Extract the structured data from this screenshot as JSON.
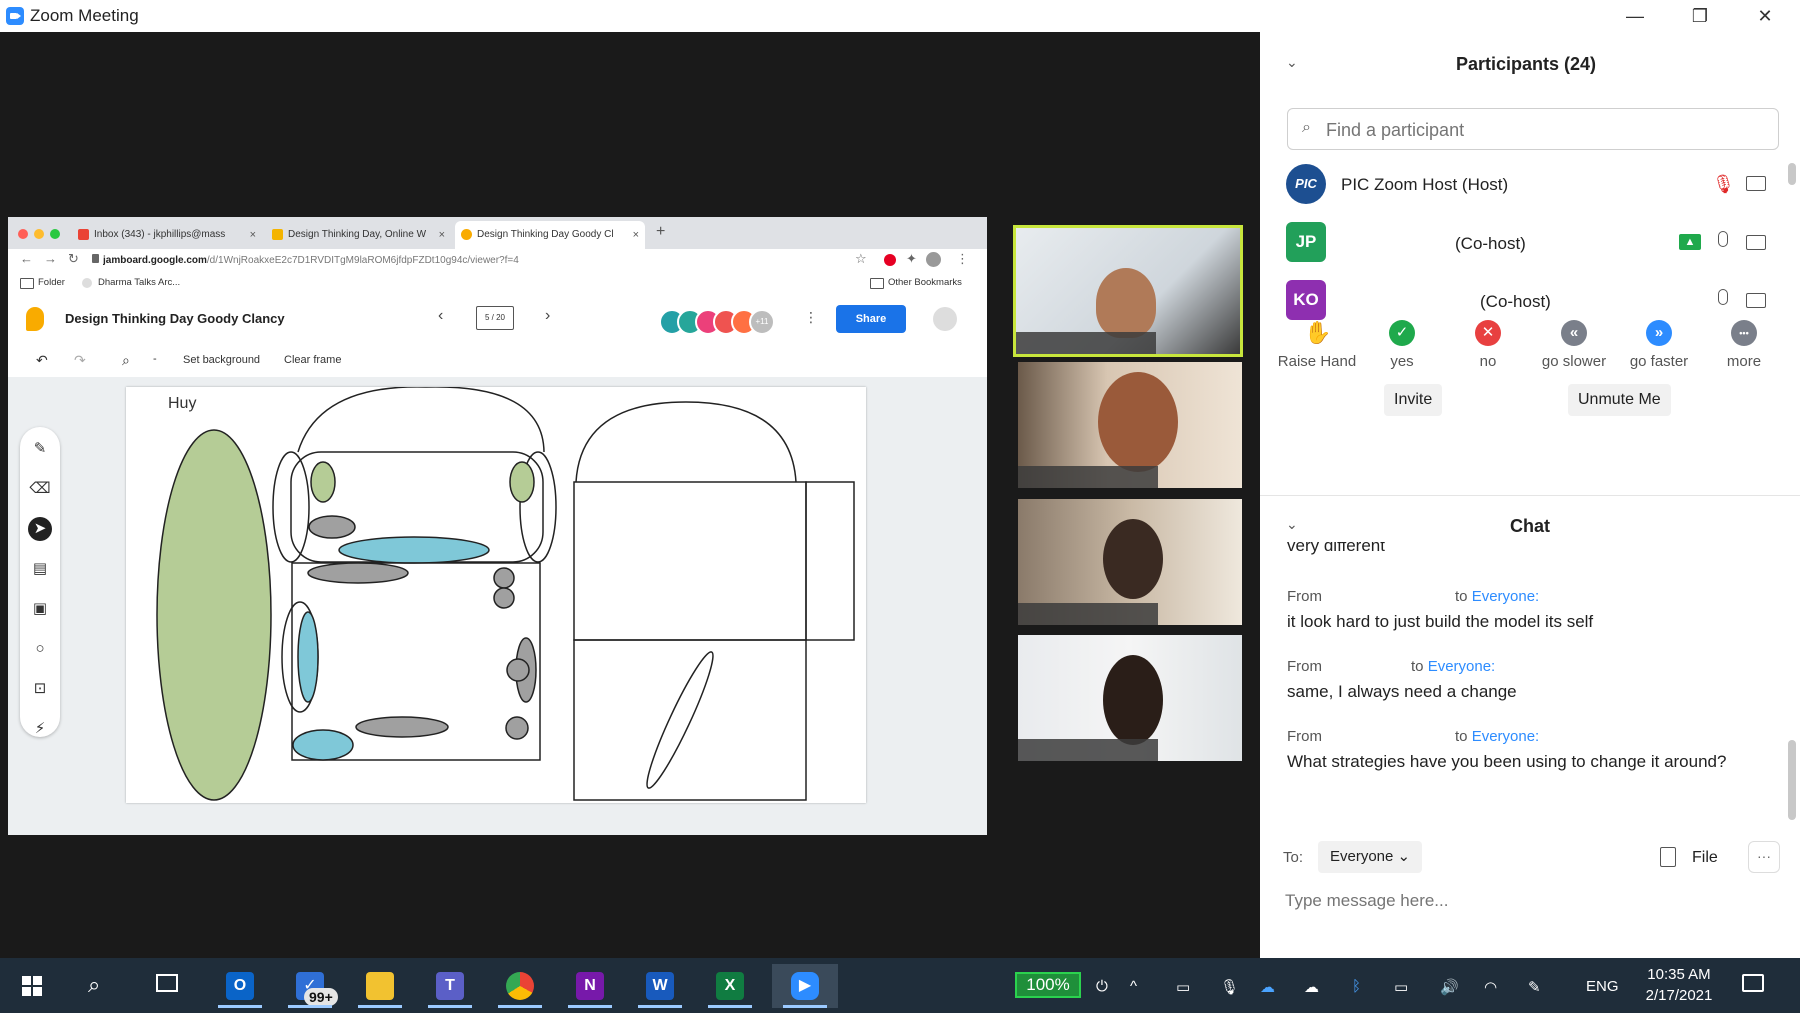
{
  "window": {
    "title": "Zoom Meeting",
    "minimize": "—",
    "restore": "❐",
    "close": "✕"
  },
  "browser": {
    "tabs": [
      {
        "label": "Inbox (343) - jkphillips@mass",
        "close": "×"
      },
      {
        "label": "Design Thinking Day, Online W",
        "close": "×"
      },
      {
        "label": "Design Thinking Day Goody Cl",
        "close": "×"
      }
    ],
    "new_tab": "+",
    "url_bold": "jamboard.google.com",
    "url_rest": "/d/1WnjRoakxeE2c7D1RVDITgM9laROM6jfdpFZDt10g94c/viewer?f=4",
    "bookmarks": [
      "Folder",
      "Dharma Talks Arc..."
    ],
    "other_bookmarks": "Other Bookmarks"
  },
  "jamboard": {
    "title": "Design Thinking Day Goody Clancy",
    "frame_counter": "5 / 20",
    "avatar_overflow": "+11",
    "share_label": "Share",
    "toolbar": {
      "set_background": "Set background",
      "clear_frame": "Clear frame",
      "zoom": "-"
    },
    "canvas_label": "Huy"
  },
  "participants": {
    "header": "Participants (24)",
    "search_placeholder": "Find a participant",
    "list": [
      {
        "initials": "",
        "name": "PIC Zoom Host (Host)",
        "avatar_text": "PIC"
      },
      {
        "initials": "JP",
        "name": "(Co-host)"
      },
      {
        "initials": "KO",
        "name": "(Co-host)"
      }
    ],
    "reactions": [
      {
        "label": "Raise Hand",
        "glyph": "✋"
      },
      {
        "label": "yes",
        "glyph": "✓"
      },
      {
        "label": "no",
        "glyph": "✕"
      },
      {
        "label": "go slower",
        "glyph": "«"
      },
      {
        "label": "go faster",
        "glyph": "»"
      },
      {
        "label": "more",
        "glyph": "•••"
      }
    ],
    "invite_label": "Invite",
    "unmute_label": "Unmute Me"
  },
  "chat": {
    "header": "Chat",
    "clipped_text": "very different",
    "messages": [
      {
        "from": "From",
        "to": "to",
        "to_target": "Everyone:",
        "text": "it look hard to just build the model its self"
      },
      {
        "from": "From",
        "to": "to",
        "to_target": "Everyone:",
        "text": "same, I always need a change"
      },
      {
        "from": "From",
        "to": "to",
        "to_target": "Everyone:",
        "text": "What strategies have you been using to change it around?"
      }
    ],
    "to_label": "To:",
    "recipient": "Everyone",
    "file_label": "File",
    "more_label": "···",
    "input_placeholder": "Type message here..."
  },
  "taskbar": {
    "badge": "99+",
    "battery": "100%",
    "language": "ENG",
    "time": "10:35 AM",
    "date": "2/17/2021"
  },
  "colors": {
    "zoom_blue": "#2d8cff",
    "shape_green": "#b5cc96",
    "shape_teal": "#7fc8d8",
    "shape_gray": "#a0a0a0",
    "active_speaker": "#c8e63c"
  }
}
